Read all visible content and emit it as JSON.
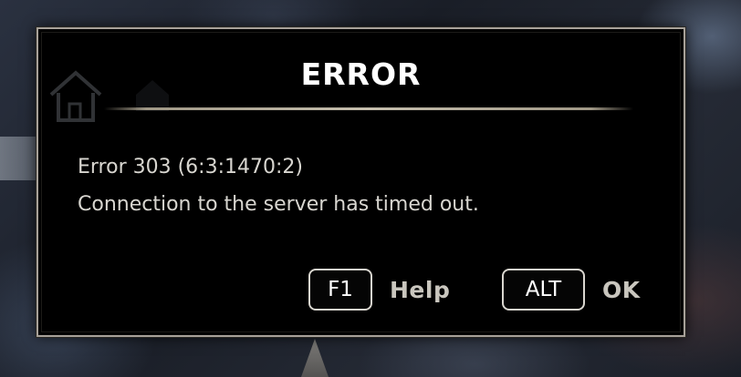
{
  "dialog": {
    "title": "ERROR",
    "message_line_1": "Error 303 (6:3:1470:2)",
    "message_line_2": "Connection to the server has timed out."
  },
  "actions": [
    {
      "key": "F1",
      "label": "Help"
    },
    {
      "key": "ALT",
      "label": "OK"
    }
  ],
  "colors": {
    "dialog_background": "#000000",
    "dialog_border": "#a7a199",
    "title_text": "#ffffff",
    "message_text": "#d8d6d0",
    "action_label_text": "#c9c6be",
    "keycap_border": "#d9d6cf"
  },
  "icons": {
    "background_home": "home-icon"
  }
}
